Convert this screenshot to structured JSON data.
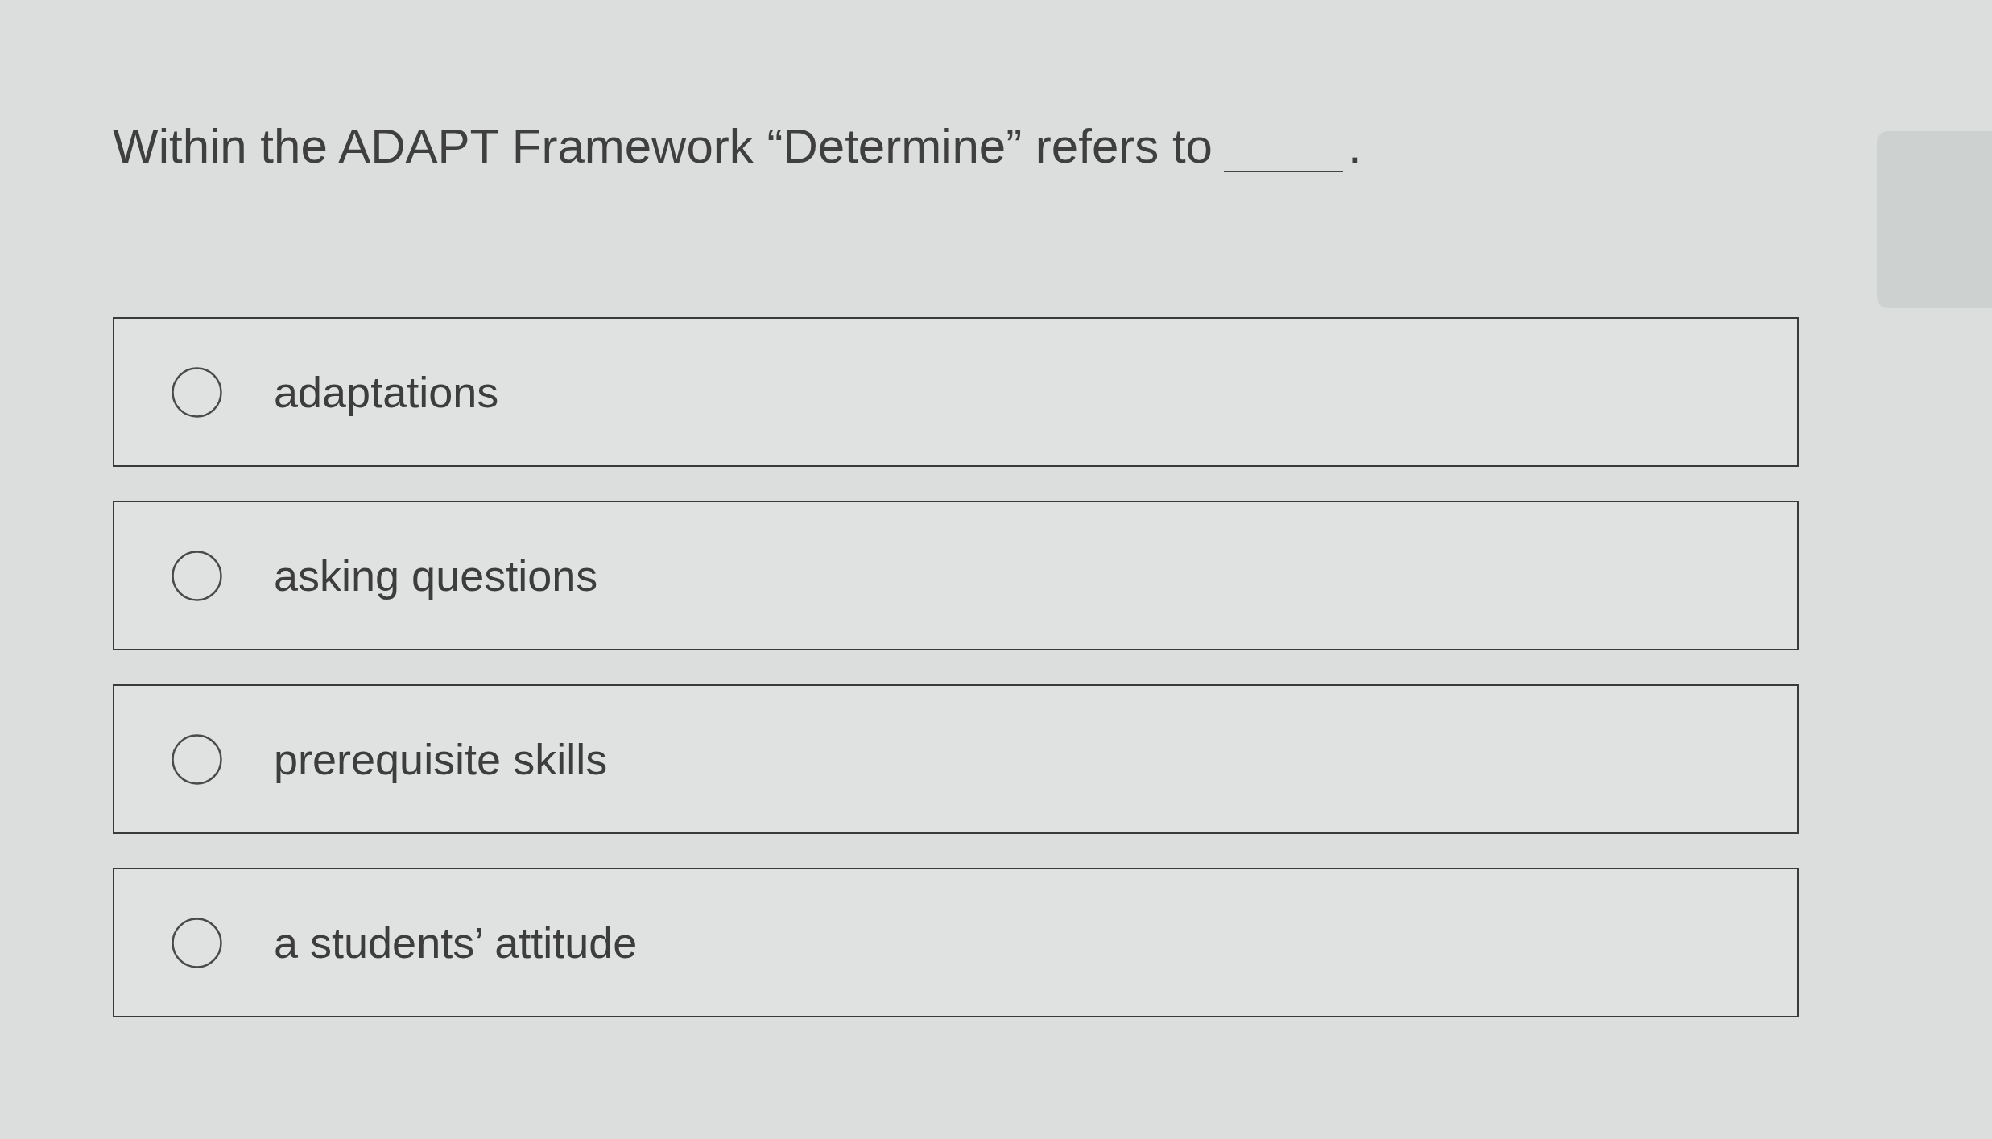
{
  "question": {
    "text": "Within the ADAPT Framework “Determine” refers to",
    "suffix": "."
  },
  "options": [
    {
      "label": "adaptations",
      "selected": false
    },
    {
      "label": "asking questions",
      "selected": false
    },
    {
      "label": "prerequisite skills",
      "selected": false
    },
    {
      "label": "a students’ attitude",
      "selected": false
    }
  ]
}
